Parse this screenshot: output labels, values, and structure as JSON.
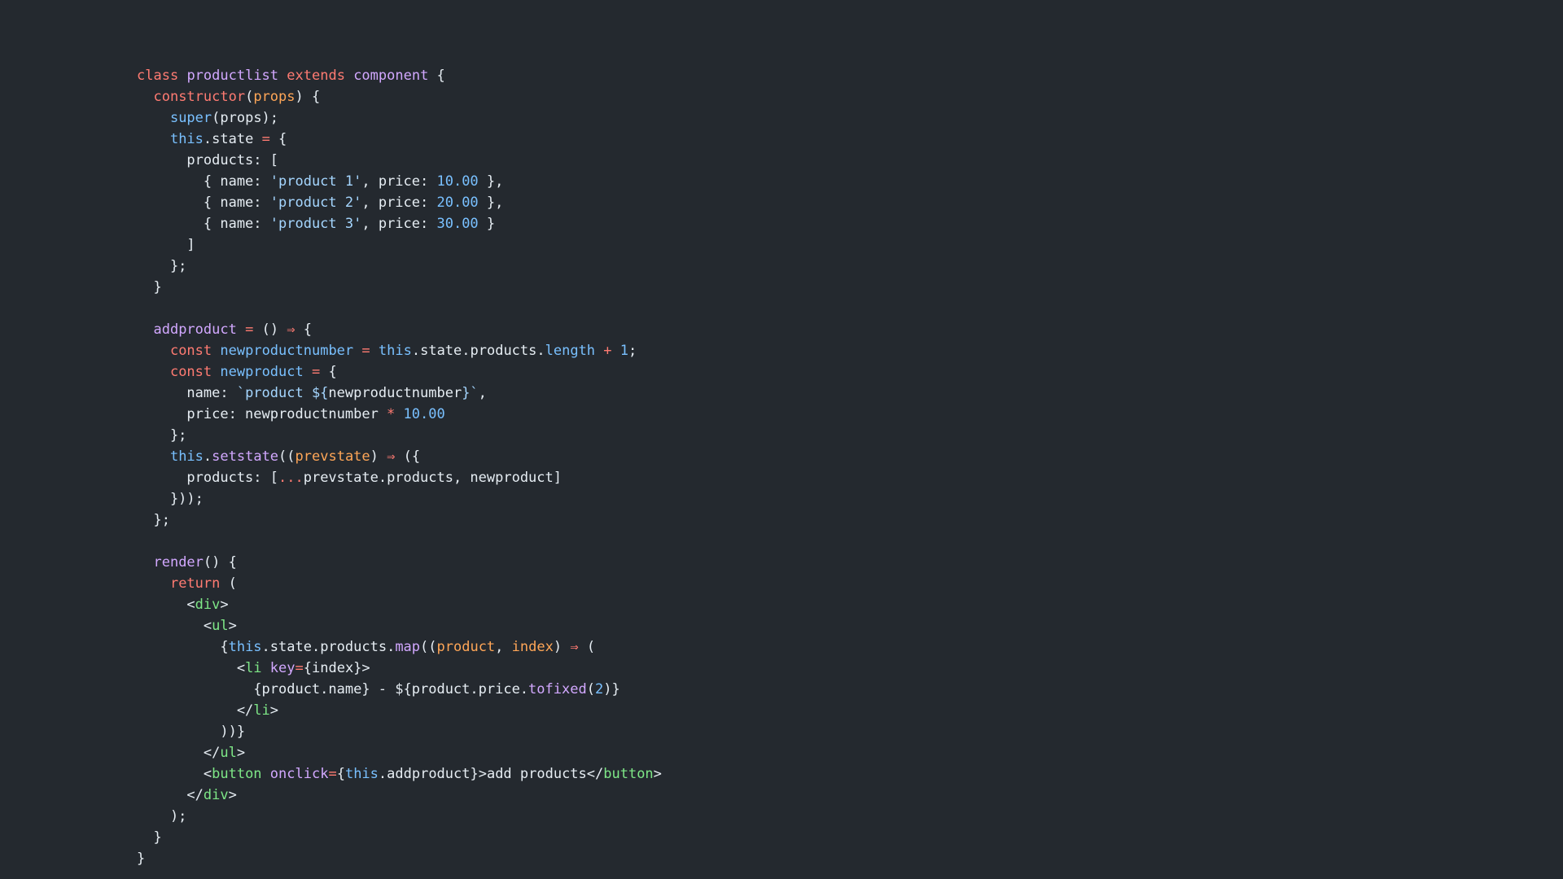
{
  "theme": {
    "background": "#24292f",
    "foreground": "#e6edf3",
    "keyword": "#ff7b72",
    "class_name": "#d2a8ff",
    "function": "#d2a8ff",
    "parameter": "#ffa657",
    "builtin": "#79c0ff",
    "string": "#a5d6ff",
    "number": "#79c0ff",
    "jsx_tag": "#7ee787"
  },
  "code": {
    "lines": [
      [
        [
          "kw",
          "class"
        ],
        [
          "plain",
          " "
        ],
        [
          "cls",
          "productlist"
        ],
        [
          "plain",
          " "
        ],
        [
          "kw",
          "extends"
        ],
        [
          "plain",
          " "
        ],
        [
          "cls",
          "component"
        ],
        [
          "plain",
          " {"
        ]
      ],
      [
        [
          "plain",
          "  "
        ],
        [
          "fn2",
          "constructor"
        ],
        [
          "plain",
          "("
        ],
        [
          "param",
          "props"
        ],
        [
          "plain",
          ") {"
        ]
      ],
      [
        [
          "plain",
          "    "
        ],
        [
          "this",
          "super"
        ],
        [
          "plain",
          "(props);"
        ]
      ],
      [
        [
          "plain",
          "    "
        ],
        [
          "this",
          "this"
        ],
        [
          "plain",
          ".state "
        ],
        [
          "op",
          "="
        ],
        [
          "plain",
          " {"
        ]
      ],
      [
        [
          "plain",
          "      products: ["
        ]
      ],
      [
        [
          "plain",
          "        { name: "
        ],
        [
          "str",
          "'product 1'"
        ],
        [
          "plain",
          ", price: "
        ],
        [
          "num",
          "10.00"
        ],
        [
          "plain",
          " },"
        ]
      ],
      [
        [
          "plain",
          "        { name: "
        ],
        [
          "str",
          "'product 2'"
        ],
        [
          "plain",
          ", price: "
        ],
        [
          "num",
          "20.00"
        ],
        [
          "plain",
          " },"
        ]
      ],
      [
        [
          "plain",
          "        { name: "
        ],
        [
          "str",
          "'product 3'"
        ],
        [
          "plain",
          ", price: "
        ],
        [
          "num",
          "30.00"
        ],
        [
          "plain",
          " }"
        ]
      ],
      [
        [
          "plain",
          "      ]"
        ]
      ],
      [
        [
          "plain",
          "    };"
        ]
      ],
      [
        [
          "plain",
          "  }"
        ]
      ],
      [],
      [
        [
          "plain",
          "  "
        ],
        [
          "fn",
          "addproduct"
        ],
        [
          "plain",
          " "
        ],
        [
          "op",
          "="
        ],
        [
          "plain",
          " () "
        ],
        [
          "op",
          "⇒"
        ],
        [
          "plain",
          " {"
        ]
      ],
      [
        [
          "plain",
          "    "
        ],
        [
          "kw",
          "const"
        ],
        [
          "plain",
          " "
        ],
        [
          "prop",
          "newproductnumber"
        ],
        [
          "plain",
          " "
        ],
        [
          "op",
          "="
        ],
        [
          "plain",
          " "
        ],
        [
          "this",
          "this"
        ],
        [
          "plain",
          ".state.products."
        ],
        [
          "prop",
          "length"
        ],
        [
          "plain",
          " "
        ],
        [
          "op",
          "+"
        ],
        [
          "plain",
          " "
        ],
        [
          "num",
          "1"
        ],
        [
          "plain",
          ";"
        ]
      ],
      [
        [
          "plain",
          "    "
        ],
        [
          "kw",
          "const"
        ],
        [
          "plain",
          " "
        ],
        [
          "prop",
          "newproduct"
        ],
        [
          "plain",
          " "
        ],
        [
          "op",
          "="
        ],
        [
          "plain",
          " {"
        ]
      ],
      [
        [
          "plain",
          "      name: "
        ],
        [
          "str",
          "`product ${"
        ],
        [
          "plain",
          "newproductnumber"
        ],
        [
          "str",
          "}`"
        ],
        [
          "plain",
          ","
        ]
      ],
      [
        [
          "plain",
          "      price: newproductnumber "
        ],
        [
          "op",
          "*"
        ],
        [
          "plain",
          " "
        ],
        [
          "num",
          "10.00"
        ]
      ],
      [
        [
          "plain",
          "    };"
        ]
      ],
      [
        [
          "plain",
          "    "
        ],
        [
          "this",
          "this"
        ],
        [
          "plain",
          "."
        ],
        [
          "fn",
          "setstate"
        ],
        [
          "plain",
          "(("
        ],
        [
          "param",
          "prevstate"
        ],
        [
          "plain",
          ") "
        ],
        [
          "op",
          "⇒"
        ],
        [
          "plain",
          " ({"
        ]
      ],
      [
        [
          "plain",
          "      products: ["
        ],
        [
          "op",
          "..."
        ],
        [
          "plain",
          "prevstate.products, newproduct]"
        ]
      ],
      [
        [
          "plain",
          "    }));"
        ]
      ],
      [
        [
          "plain",
          "  };"
        ]
      ],
      [],
      [
        [
          "plain",
          "  "
        ],
        [
          "fn",
          "render"
        ],
        [
          "plain",
          "() {"
        ]
      ],
      [
        [
          "plain",
          "    "
        ],
        [
          "kw",
          "return"
        ],
        [
          "plain",
          " ("
        ]
      ],
      [
        [
          "plain",
          "      <"
        ],
        [
          "tag",
          "div"
        ],
        [
          "plain",
          ">"
        ]
      ],
      [
        [
          "plain",
          "        <"
        ],
        [
          "tag",
          "ul"
        ],
        [
          "plain",
          ">"
        ]
      ],
      [
        [
          "plain",
          "          {"
        ],
        [
          "this",
          "this"
        ],
        [
          "plain",
          ".state.products."
        ],
        [
          "fn",
          "map"
        ],
        [
          "plain",
          "(("
        ],
        [
          "param",
          "product"
        ],
        [
          "plain",
          ", "
        ],
        [
          "param",
          "index"
        ],
        [
          "plain",
          ") "
        ],
        [
          "op",
          "⇒"
        ],
        [
          "plain",
          " ("
        ]
      ],
      [
        [
          "plain",
          "            <"
        ],
        [
          "tag",
          "li"
        ],
        [
          "plain",
          " "
        ],
        [
          "attr",
          "key"
        ],
        [
          "op",
          "="
        ],
        [
          "plain",
          "{index}>"
        ]
      ],
      [
        [
          "plain",
          "              {product.name} - ${product.price."
        ],
        [
          "fn",
          "tofixed"
        ],
        [
          "plain",
          "("
        ],
        [
          "num",
          "2"
        ],
        [
          "plain",
          ")}"
        ]
      ],
      [
        [
          "plain",
          "            </"
        ],
        [
          "tag",
          "li"
        ],
        [
          "plain",
          ">"
        ]
      ],
      [
        [
          "plain",
          "          ))}"
        ]
      ],
      [
        [
          "plain",
          "        </"
        ],
        [
          "tag",
          "ul"
        ],
        [
          "plain",
          ">"
        ]
      ],
      [
        [
          "plain",
          "        <"
        ],
        [
          "tag",
          "button"
        ],
        [
          "plain",
          " "
        ],
        [
          "attr",
          "onclick"
        ],
        [
          "op",
          "="
        ],
        [
          "plain",
          "{"
        ],
        [
          "this",
          "this"
        ],
        [
          "plain",
          ".addproduct}>add products</"
        ],
        [
          "tag",
          "button"
        ],
        [
          "plain",
          ">"
        ]
      ],
      [
        [
          "plain",
          "      </"
        ],
        [
          "tag",
          "div"
        ],
        [
          "plain",
          ">"
        ]
      ],
      [
        [
          "plain",
          "    );"
        ]
      ],
      [
        [
          "plain",
          "  }"
        ]
      ],
      [
        [
          "plain",
          "}"
        ]
      ]
    ]
  }
}
